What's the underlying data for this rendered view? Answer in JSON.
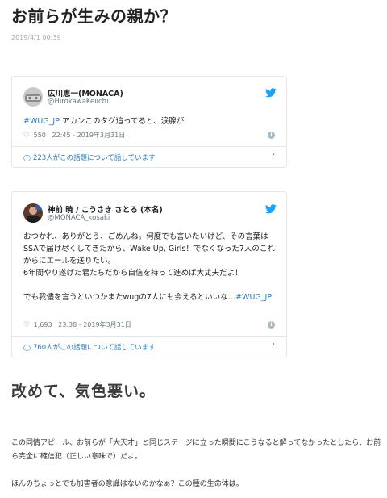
{
  "article": {
    "title": "お前らが生みの親か？",
    "date": "2019/4/1 00:39",
    "subheading": "改めて、気色悪い。",
    "paragraphs": [
      "この同情アピール、お前らが「大天才」と同じステージに立った瞬間にこうなると解ってなかったとしたら、お前ら完全に確信犯（正しい意味で）だよ。",
      "ほんのちょっとでも加害者の意識はないのかなぁ？この種の生命体は。"
    ]
  },
  "tweets": [
    {
      "name": "広川恵一(MONACA)",
      "handle": "@HirokawaKeiichi",
      "hashtag": "#WUG_JP",
      "text": " アカンこのタグ追ってると、涙腺が",
      "likes": "550",
      "time": "22:45 - 2019年3月31日",
      "talking": "223人がこの話題について話しています"
    },
    {
      "name": "神前 暁 / こうさき さとる (本名)",
      "handle": "@MONACA_kosaki",
      "text": "おつかれ、ありがとう、ごめんね。何度でも言いたいけど、その言葉はSSAで届け尽くしてきたから、Wake Up, Girls！でなくなった7人のこれからにエールを送りたい。\n6年間やり遂げた君たちだから自信を持って進めば大丈夫だよ！\n\nでも我儘を言うといつかまたwugの7人にも会えるといいな…",
      "hashtag": "#WUG_JP",
      "likes": "1,693",
      "time": "23:38 - 2019年3月31日",
      "talking": "760人がこの話題について話しています"
    }
  ],
  "icons": {
    "like": "heart-icon",
    "info": "info-icon",
    "talk": "speech-bubble-icon",
    "chevron": "chevron-right-icon",
    "twitter": "twitter-bird-icon"
  },
  "colors": {
    "link": "#2b7bb9",
    "twitter_blue": "#1da1f2",
    "border": "#e1e8ed",
    "muted": "#697882"
  }
}
